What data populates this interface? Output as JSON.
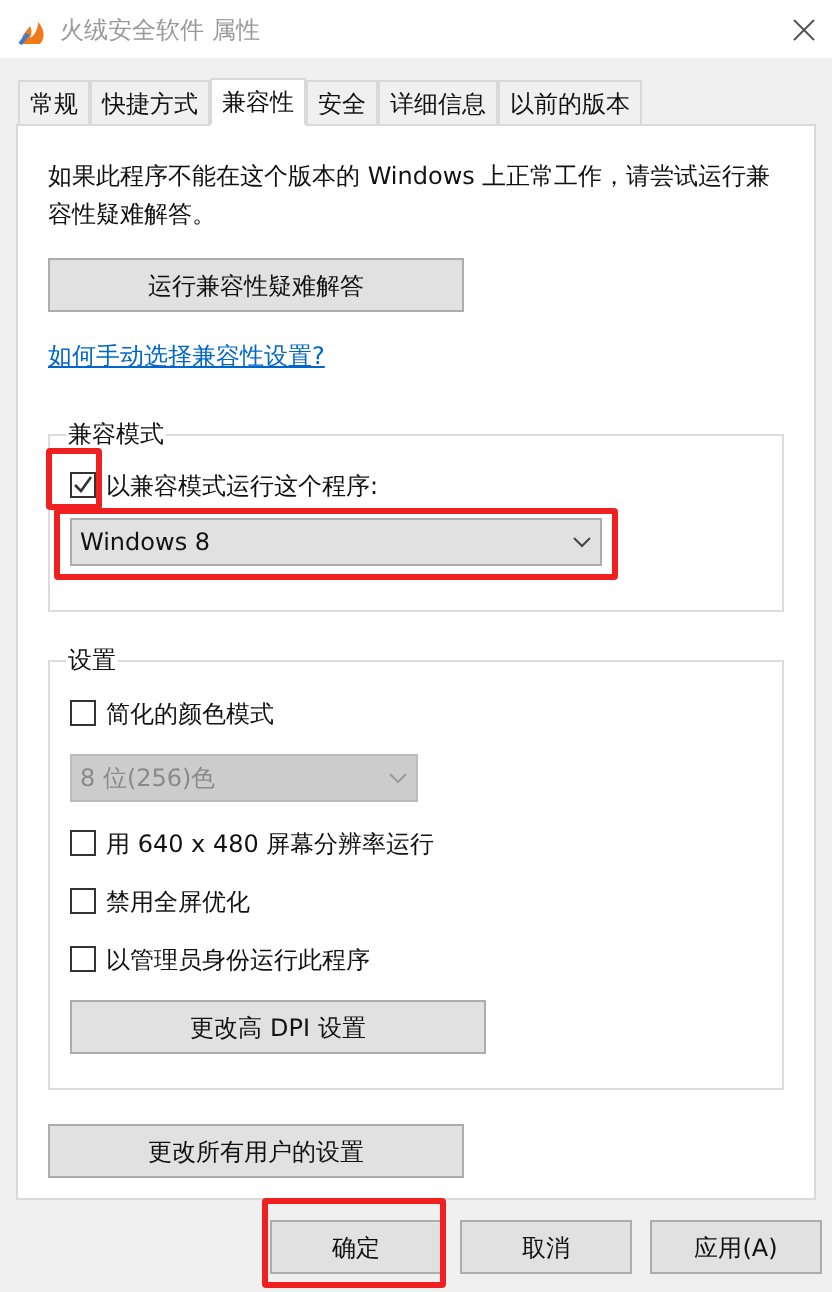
{
  "window": {
    "title": "火绒安全软件 属性"
  },
  "tabs": [
    {
      "label": "常规",
      "selected": false
    },
    {
      "label": "快捷方式",
      "selected": false
    },
    {
      "label": "兼容性",
      "selected": true
    },
    {
      "label": "安全",
      "selected": false
    },
    {
      "label": "详细信息",
      "selected": false
    },
    {
      "label": "以前的版本",
      "selected": false
    }
  ],
  "intro": "如果此程序不能在这个版本的 Windows 上正常工作，请尝试运行兼容性疑难解答。",
  "troubleshoot_button": "运行兼容性疑难解答",
  "help_link": "如何手动选择兼容性设置?",
  "compat_mode": {
    "title": "兼容模式",
    "checkbox": {
      "label": "以兼容模式运行这个程序:",
      "checked": true,
      "highlighted": true
    },
    "dropdown": {
      "value": "Windows 8",
      "disabled": false,
      "highlighted": true
    }
  },
  "settings": {
    "title": "设置",
    "items": [
      {
        "kind": "checkbox",
        "label": "简化的颜色模式",
        "checked": false
      },
      {
        "kind": "dropdown",
        "value": "8 位(256)色",
        "disabled": true
      },
      {
        "kind": "checkbox",
        "label": "用 640 x 480 屏幕分辨率运行",
        "checked": false
      },
      {
        "kind": "checkbox",
        "label": "禁用全屏优化",
        "checked": false
      },
      {
        "kind": "checkbox",
        "label": "以管理员身份运行此程序",
        "checked": false
      },
      {
        "kind": "button",
        "label": "更改高 DPI 设置"
      }
    ]
  },
  "all_users_button": "更改所有用户的设置",
  "buttons": [
    {
      "label": "确定",
      "highlighted": true
    },
    {
      "label": "取消",
      "highlighted": false
    },
    {
      "label": "应用(A)",
      "highlighted": false
    }
  ]
}
